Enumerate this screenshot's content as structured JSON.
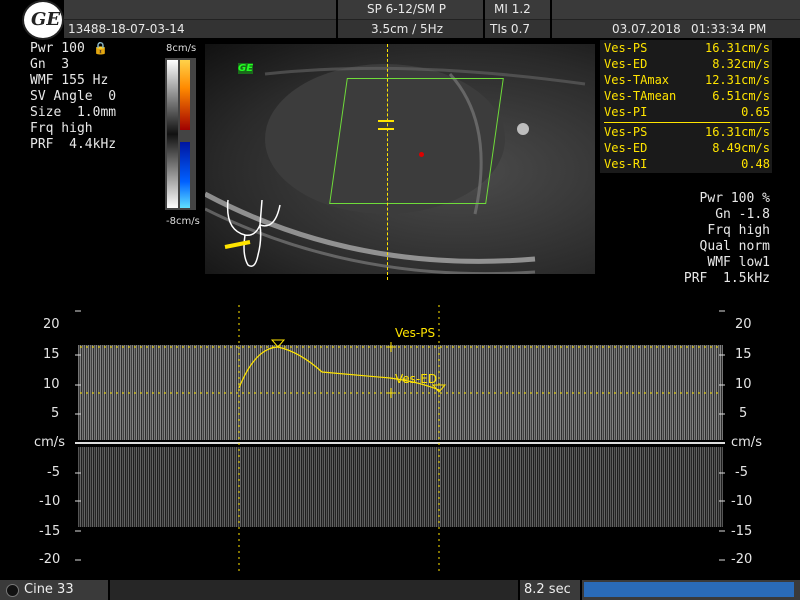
{
  "header": {
    "patient_id": "13488-18-07-03-14",
    "probe": "SP 6-12/SM P",
    "mi": "MI  1.2",
    "depth_freq": "3.5cm / 5Hz",
    "tis": "TIs  0.7",
    "date": "03.07.2018",
    "time": "01:33:34 PM"
  },
  "logo_text": "GE",
  "left_params": [
    "Pwr 100",
    "Gn  3",
    "WMF 155 Hz",
    "SV Angle  0",
    "Size  1.0mm",
    "Frq high",
    "PRF  4.4kHz"
  ],
  "colorbar": {
    "top_label": "8cm/s",
    "bottom_label": "-8cm/s"
  },
  "image_tag": "GE",
  "measurements": [
    {
      "label": "Ves-PS",
      "value": "16.31cm/s"
    },
    {
      "label": "Ves-ED",
      "value": "8.32cm/s"
    },
    {
      "label": "Ves-TAmax",
      "value": "12.31cm/s"
    },
    {
      "label": "Ves-TAmean",
      "value": "6.51cm/s"
    },
    {
      "label": "Ves-PI",
      "value": "0.65"
    },
    {
      "label": "Ves-PS",
      "value": "16.31cm/s"
    },
    {
      "label": "Ves-ED",
      "value": "8.49cm/s"
    },
    {
      "label": "Ves-RI",
      "value": "0.48"
    }
  ],
  "right_params": [
    "Pwr 100 %",
    "Gn -1.8",
    "Frq high",
    "Qual norm",
    "WMF low1",
    "PRF  1.5kHz"
  ],
  "spectral": {
    "ticks": [
      "20",
      "15",
      "10",
      "5",
      "cm/s",
      "-5",
      "-10",
      "-15",
      "-20"
    ],
    "ps_label": "Ves-PS",
    "ed_label": "Ves-ED"
  },
  "footer": {
    "cine": "Cine 33",
    "duration": "8.2 sec"
  },
  "colors": {
    "measure": "#ffe400",
    "roi": "#6fdc3a",
    "progress": "#2a6bb8"
  }
}
